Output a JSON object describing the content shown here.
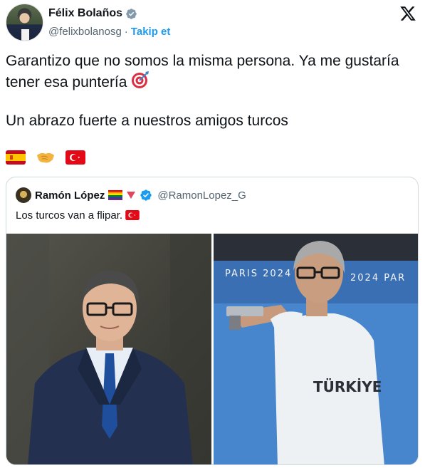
{
  "author": {
    "name": "Félix Bolaños",
    "handle": "@felixbolanosg",
    "separator": "·",
    "follow_label": "Takip et"
  },
  "tweet": {
    "line1": "Garantizo que no somos la misma persona. Ya me gustaría",
    "line2": "tener esa puntería",
    "line3": "Un abrazo fuerte a nuestros amigos turcos"
  },
  "emoji_icons": [
    "direct-hit-icon",
    "spain-flag-icon",
    "handshake-icon",
    "turkey-flag-icon"
  ],
  "quoted": {
    "name": "Ramón López",
    "handle": "@RamonLopez_G",
    "text": "Los turcos van a flipar."
  },
  "images": {
    "right_banner_left": "PARIS 2024",
    "right_banner_right": "2024 PAR",
    "right_shirt": "TÜRKİYE"
  },
  "colors": {
    "accent": "#1d9bf0",
    "text": "#0f1419",
    "secondary": "#536471",
    "border": "#cfd9de"
  }
}
